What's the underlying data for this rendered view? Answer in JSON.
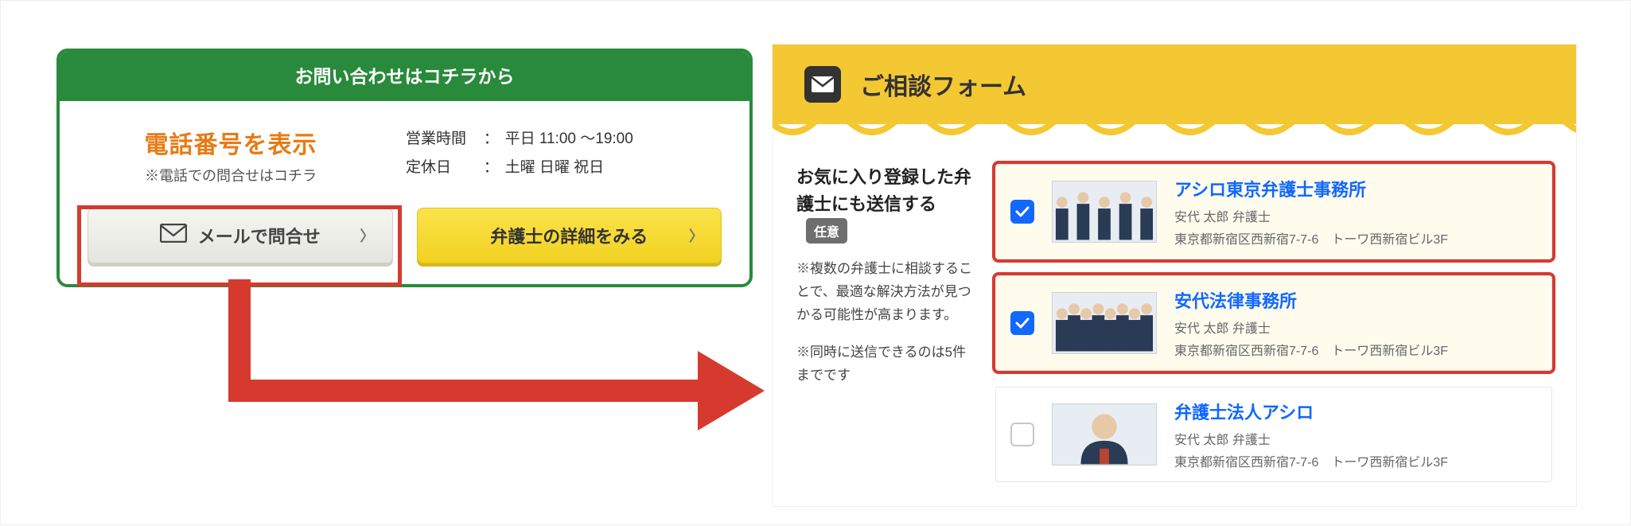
{
  "contact": {
    "head": "お問い合わせはコチラから",
    "phone_title": "電話番号を表示",
    "phone_sub": "※電話での問合せはコチラ",
    "hours_label": "営業時間",
    "hours_value": "平日  11:00 ～19:00",
    "holiday_label": "定休日",
    "holiday_value": "土曜 日曜 祝日",
    "mail_btn": "メールで問合せ",
    "detail_btn": "弁護士の詳細をみる"
  },
  "form": {
    "head": "ご相談フォーム",
    "left_title": "お気に入り登録した弁護士にも送信する",
    "badge": "任意",
    "note1": "※複数の弁護士に相談することで、最適な解決方法が見つかる可能性が高まります。",
    "note2": "※同時に送信できるのは5件までです"
  },
  "lawyers": [
    {
      "checked": true,
      "name": "アシロ東京弁護士事務所",
      "sub": "安代 太郎 弁護士",
      "addr": "東京都新宿区西新宿7-7-6　トーワ西新宿ビル3F"
    },
    {
      "checked": true,
      "name": "安代法律事務所",
      "sub": "安代 太郎 弁護士",
      "addr": "東京都新宿区西新宿7-7-6　トーワ西新宿ビル3F"
    },
    {
      "checked": false,
      "name": "弁護士法人アシロ",
      "sub": "安代 太郎 弁護士",
      "addr": "東京都新宿区西新宿7-7-6　トーワ西新宿ビル3F"
    }
  ]
}
